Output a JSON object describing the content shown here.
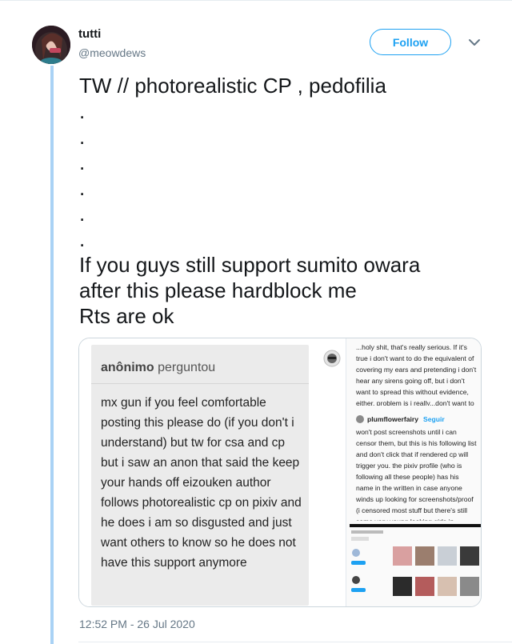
{
  "tweet": {
    "author_name": "tutti",
    "author_handle": "@meowdews",
    "follow_label": "Follow",
    "text": "TW // photorealistic CP , pedofilia\n.\n.\n.\n.\n.\n.\nIf you guys still support sumito owara\nafter this please hardblock me\nRts are ok",
    "timestamp": "12:52 PM - 26 Jul 2020"
  },
  "media": {
    "ask": {
      "asker": "anônimo",
      "verb": "perguntou",
      "body": "mx gun if you feel comfortable posting this please do (if you don't i understand) but tw for csa and cp but i saw an anon that said the keep your hands off eizouken author follows photorealistic cp on pixiv and he does i am so disgusted and just want others to know so he does not have this support anymore"
    },
    "screenshot": {
      "top_text": "...holy shit, that's really serious. If it's true i don't want to do the equivalent of covering my ears and pretending i don't hear any sirens going off, but i don't want to spread this without evidence, either. problem is i really...don't want to see images like that...",
      "user": "plumflowerfairy",
      "follow_label": "Seguir",
      "reply_text": "won't post screenshots until i can censor them, but this is his following list and don't click that if rendered cp will trigger you. the pixiv profile (who is following all these people) has his name in the written in case anyone winds up looking for screenshots/proof (i censored most stuff but there's still some very young looking girls in revealing clothing)"
    }
  }
}
